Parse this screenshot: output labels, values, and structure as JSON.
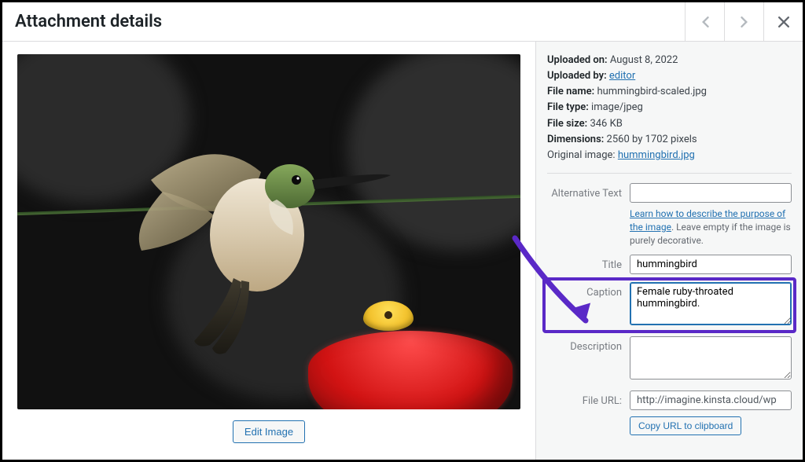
{
  "header": {
    "title": "Attachment details"
  },
  "meta": {
    "uploaded_on_label": "Uploaded on:",
    "uploaded_on": "August 8, 2022",
    "uploaded_by_label": "Uploaded by:",
    "uploaded_by": "editor",
    "file_name_label": "File name:",
    "file_name": "hummingbird-scaled.jpg",
    "file_type_label": "File type:",
    "file_type": "image/jpeg",
    "file_size_label": "File size:",
    "file_size": "346 KB",
    "dimensions_label": "Dimensions:",
    "dimensions": "2560 by 1702 pixels",
    "original_image_label": "Original image:",
    "original_image": "hummingbird.jpg"
  },
  "form": {
    "alt_label": "Alternative Text",
    "alt_value": "",
    "alt_help_link": "Learn how to describe the purpose of the image",
    "alt_help_rest": ". Leave empty if the image is purely decorative.",
    "title_label": "Title",
    "title_value": "hummingbird",
    "caption_label": "Caption",
    "caption_value": "Female ruby-throated hummingbird.",
    "description_label": "Description",
    "description_value": "",
    "file_url_label": "File URL:",
    "file_url_value": "http://imagine.kinsta.cloud/wp",
    "copy_url_label": "Copy URL to clipboard"
  },
  "buttons": {
    "edit_image": "Edit Image"
  }
}
